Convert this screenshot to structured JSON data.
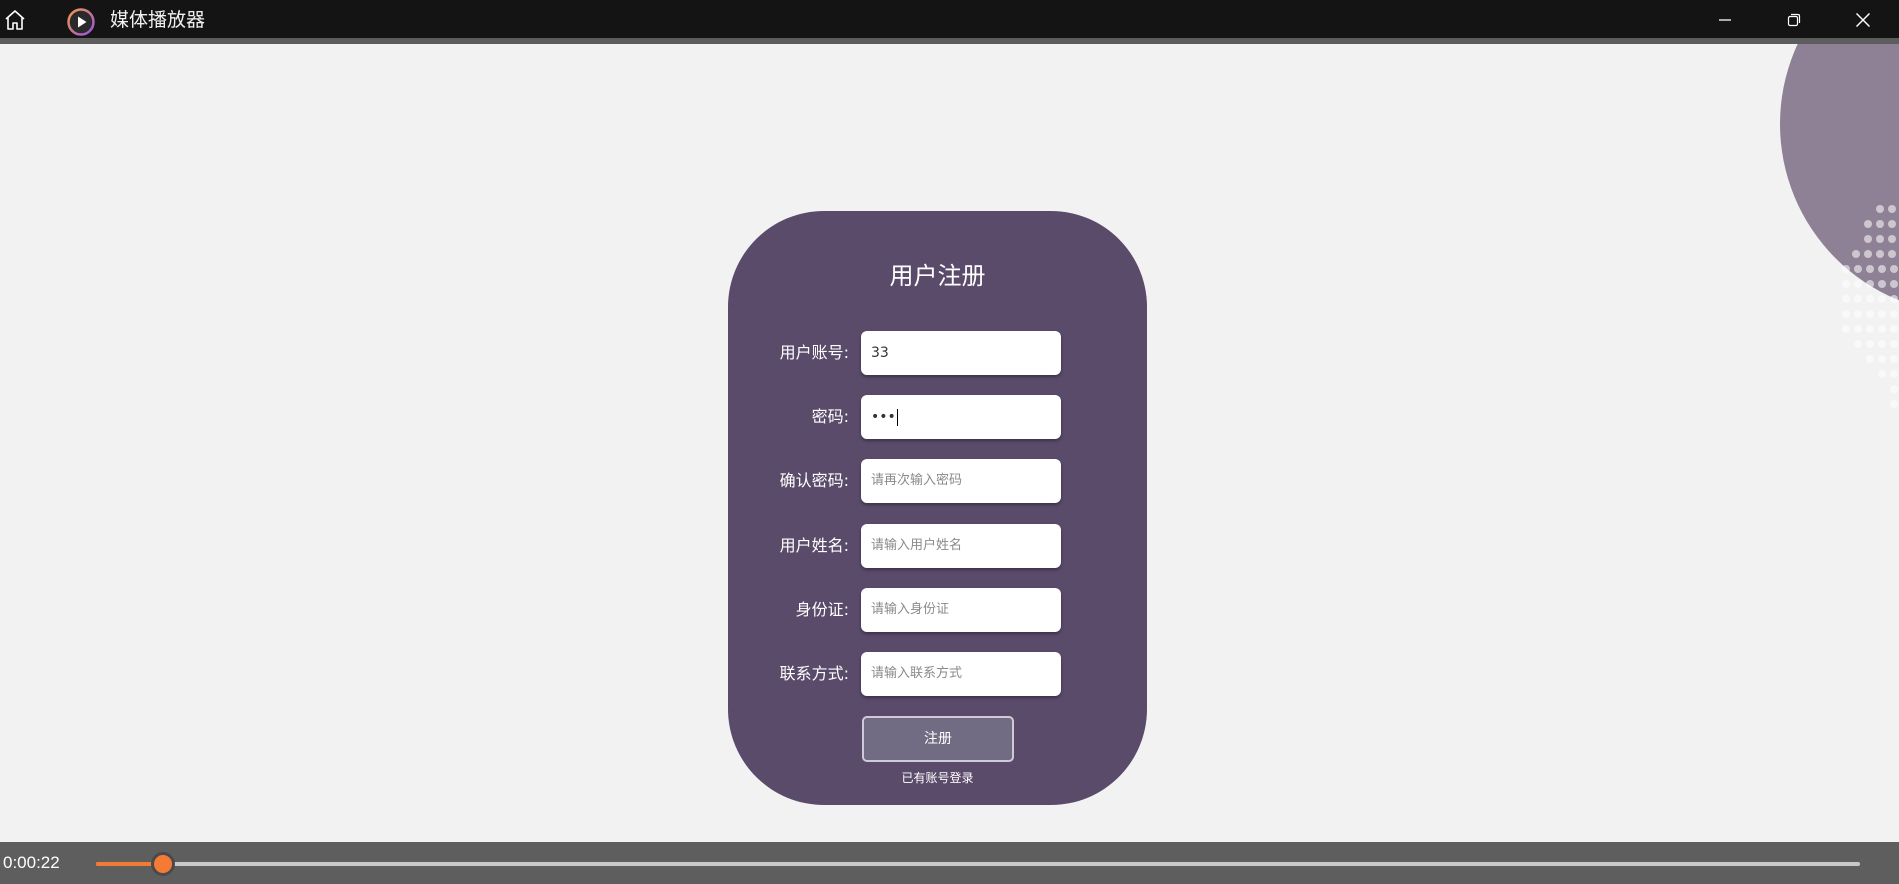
{
  "titlebar": {
    "title": "媒体播放器",
    "icons": {
      "home": "home-icon",
      "app": "play-icon",
      "minimize": "minimize-icon",
      "restore": "restore-icon",
      "close": "close-icon"
    }
  },
  "form": {
    "heading": "用户注册",
    "fields": [
      {
        "label": "用户账号:",
        "value": "33",
        "placeholder": ""
      },
      {
        "label": "密码:",
        "value": "•••",
        "placeholder": ""
      },
      {
        "label": "确认密码:",
        "value": "",
        "placeholder": "请再次输入密码"
      },
      {
        "label": "用户姓名:",
        "value": "",
        "placeholder": "请输入用户姓名"
      },
      {
        "label": "身份证:",
        "value": "",
        "placeholder": "请输入身份证"
      },
      {
        "label": "联系方式:",
        "value": "",
        "placeholder": "请输入联系方式"
      }
    ],
    "submit_label": "注册",
    "login_link": "已有账号登录"
  },
  "player": {
    "time": "0:00:22",
    "progress_fraction": 0.038
  },
  "colors": {
    "card": "#5a4b6b",
    "accent": "#f07a36",
    "titlebar": "#141414"
  }
}
